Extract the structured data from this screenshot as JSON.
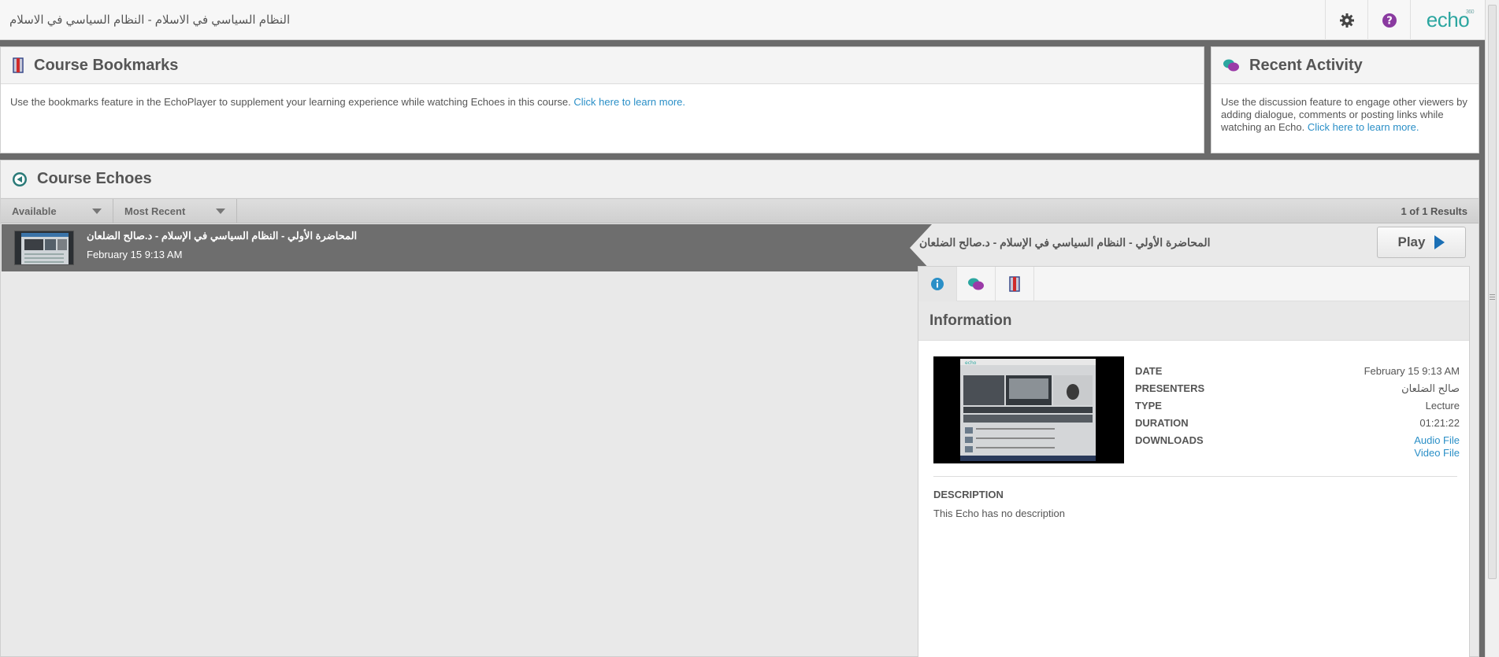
{
  "topbar": {
    "title": "النظام السياسي في الاسلام - النظام السياسي في الاسلام",
    "logo_text": "echo",
    "logo_sup": "360"
  },
  "bookmarks": {
    "heading": "Course Bookmarks",
    "text": "Use the bookmarks feature in the EchoPlayer to supplement your learning experience while watching Echoes in this course. ",
    "link": "Click here to learn more."
  },
  "recent": {
    "heading": "Recent Activity",
    "text": "Use the discussion feature to engage other viewers by adding dialogue, comments or posting links while watching an Echo. ",
    "link": "Click here to learn more."
  },
  "echoes": {
    "heading": "Course Echoes",
    "filters": [
      "Available",
      "Most Recent"
    ],
    "results": "1 of 1 Results",
    "items": [
      {
        "title": "المحاضرة الأولي - النظام السياسي في الإسلام - د.صالح الضلعان",
        "date": "February 15 9:13 AM"
      }
    ]
  },
  "detail": {
    "title": "المحاضرة الأولي - النظام السياسي في الإسلام - د.صالح الضلعان",
    "play_label": "Play",
    "info_heading": "Information",
    "date_label": "DATE",
    "date_value": "February 15 9:13 AM",
    "presenters_label": "PRESENTERS",
    "presenters_value": "صالح الضلعان",
    "type_label": "TYPE",
    "type_value": "Lecture",
    "duration_label": "DURATION",
    "duration_value": "01:21:22",
    "downloads_label": "DOWNLOADS",
    "downloads": [
      "Audio File",
      "Video File"
    ],
    "description_label": "DESCRIPTION",
    "description_value": "This Echo has no description"
  },
  "colors": {
    "accent_link": "#2a8fc7",
    "brand_teal": "#2ca6a0",
    "row_selected": "#6e6e6e"
  }
}
